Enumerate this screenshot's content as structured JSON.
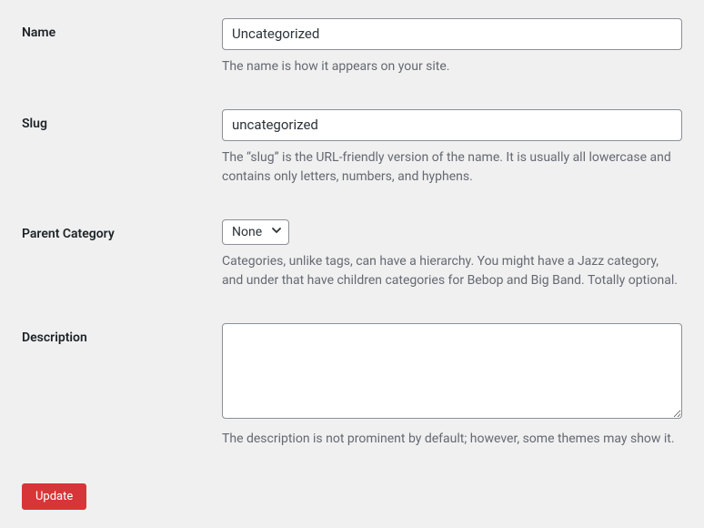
{
  "fields": {
    "name": {
      "label": "Name",
      "value": "Uncategorized",
      "description": "The name is how it appears on your site."
    },
    "slug": {
      "label": "Slug",
      "value": "uncategorized",
      "description": "The “slug” is the URL-friendly version of the name. It is usually all lowercase and contains only letters, numbers, and hyphens."
    },
    "parent": {
      "label": "Parent Category",
      "selected": "None",
      "description": "Categories, unlike tags, can have a hierarchy. You might have a Jazz category, and under that have children categories for Bebop and Big Band. Totally optional."
    },
    "description": {
      "label": "Description",
      "value": "",
      "description": "The description is not prominent by default; however, some themes may show it."
    }
  },
  "actions": {
    "submit_label": "Update"
  }
}
